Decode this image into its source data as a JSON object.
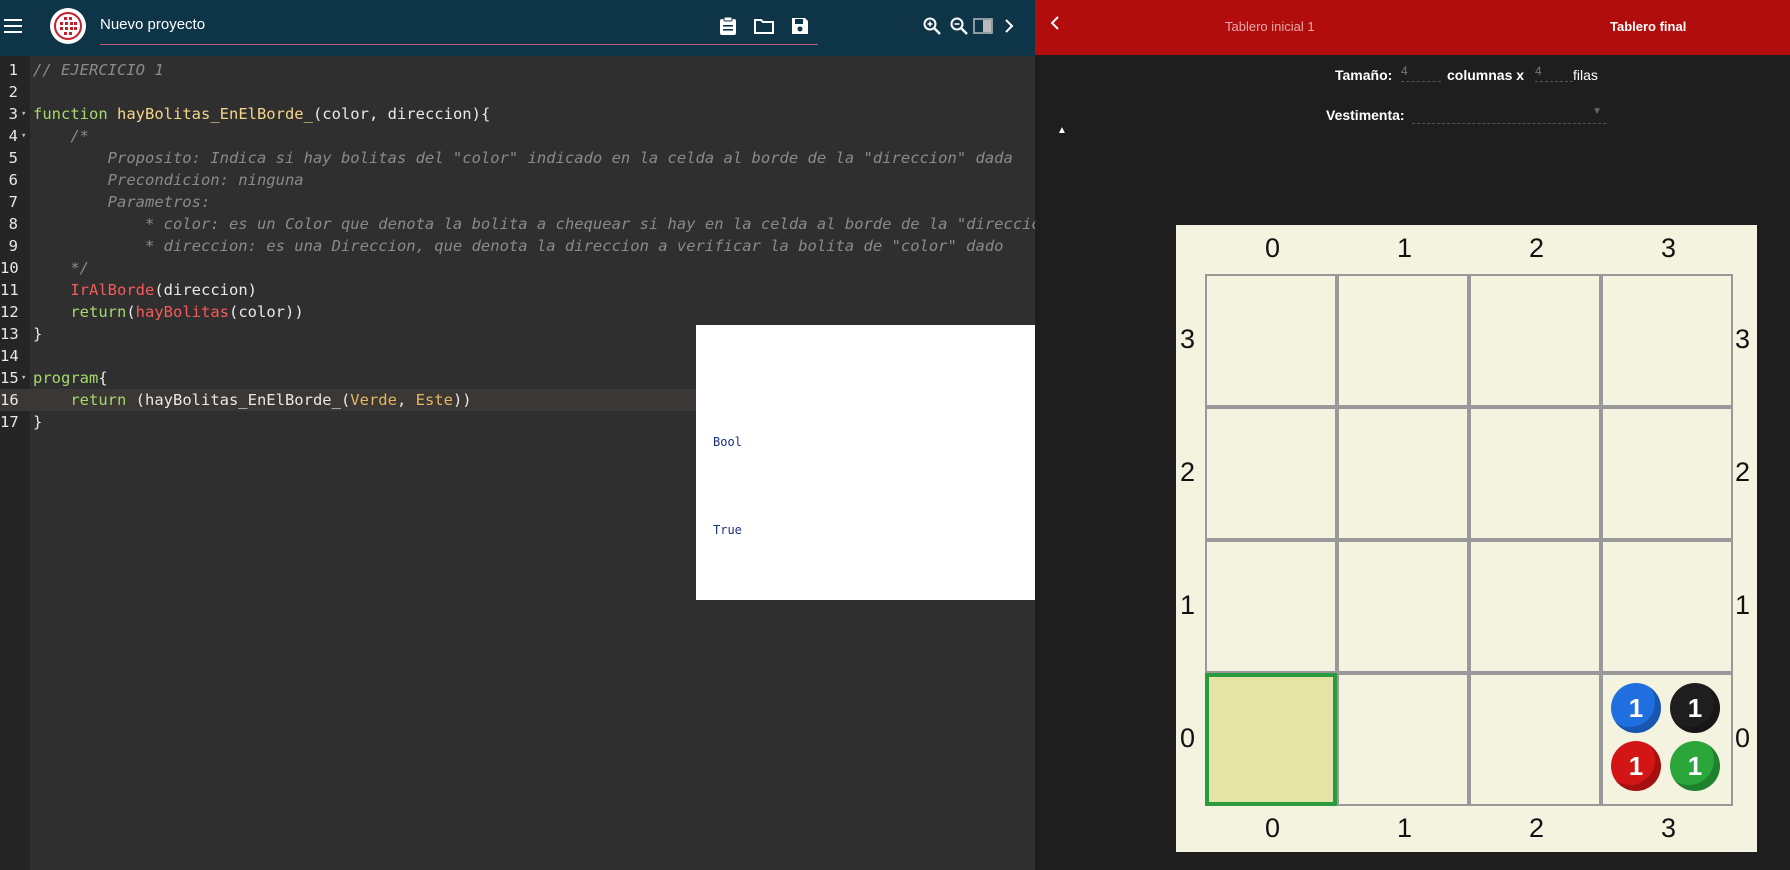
{
  "header": {
    "title": "Nuevo proyecto"
  },
  "editor": {
    "lines": [
      {
        "n": "1",
        "fold": "",
        "parts": [
          {
            "t": "// EJERCICIO 1",
            "c": "c-comment"
          }
        ]
      },
      {
        "n": "2",
        "fold": "",
        "parts": []
      },
      {
        "n": "3",
        "fold": "▾",
        "parts": [
          {
            "t": "function ",
            "c": "c-kw"
          },
          {
            "t": "hayBolitas_EnElBorde_",
            "c": "c-fn"
          },
          {
            "t": "(color, direccion){",
            "c": ""
          }
        ]
      },
      {
        "n": "4",
        "fold": "▾",
        "parts": [
          {
            "t": "    /*",
            "c": "c-comment"
          }
        ]
      },
      {
        "n": "5",
        "fold": "",
        "parts": [
          {
            "t": "        Proposito: Indica si hay bolitas del \"color\" indicado en la celda al borde de la \"direccion\" dada",
            "c": "c-comment"
          }
        ]
      },
      {
        "n": "6",
        "fold": "",
        "parts": [
          {
            "t": "        Precondicion: ninguna",
            "c": "c-comment"
          }
        ]
      },
      {
        "n": "7",
        "fold": "",
        "parts": [
          {
            "t": "        Parametros:",
            "c": "c-comment"
          }
        ]
      },
      {
        "n": "8",
        "fold": "",
        "parts": [
          {
            "t": "            * color: es un Color que denota la bolita a chequear si hay en la celda al borde de la \"direccion\"",
            "c": "c-comment"
          }
        ]
      },
      {
        "n": "9",
        "fold": "",
        "parts": [
          {
            "t": "            * direccion: es una Direccion, que denota la direccion a verificar la bolita de \"color\" dado",
            "c": "c-comment"
          }
        ]
      },
      {
        "n": "10",
        "fold": "",
        "parts": [
          {
            "t": "    */",
            "c": "c-comment"
          }
        ]
      },
      {
        "n": "11",
        "fold": "",
        "parts": [
          {
            "t": "    ",
            "c": ""
          },
          {
            "t": "IrAlBorde",
            "c": "c-red"
          },
          {
            "t": "(direccion)",
            "c": ""
          }
        ]
      },
      {
        "n": "12",
        "fold": "",
        "parts": [
          {
            "t": "    ",
            "c": ""
          },
          {
            "t": "return",
            "c": "c-kw"
          },
          {
            "t": "(",
            "c": ""
          },
          {
            "t": "hayBolitas",
            "c": "c-red"
          },
          {
            "t": "(color))",
            "c": ""
          }
        ]
      },
      {
        "n": "13",
        "fold": "",
        "parts": [
          {
            "t": "}",
            "c": ""
          }
        ]
      },
      {
        "n": "14",
        "fold": "",
        "parts": []
      },
      {
        "n": "15",
        "fold": "▾",
        "parts": [
          {
            "t": "program",
            "c": "c-kw"
          },
          {
            "t": "{",
            "c": ""
          }
        ]
      },
      {
        "n": "16",
        "fold": "",
        "active": true,
        "parts": [
          {
            "t": "    ",
            "c": ""
          },
          {
            "t": "return",
            "c": "c-kw"
          },
          {
            "t": " (hayBolitas_EnElBorde_(",
            "c": ""
          },
          {
            "t": "Verde",
            "c": "c-const"
          },
          {
            "t": ", ",
            "c": ""
          },
          {
            "t": "Este",
            "c": "c-const"
          },
          {
            "t": "))",
            "c": ""
          }
        ]
      },
      {
        "n": "17",
        "fold": "",
        "parts": [
          {
            "t": "}",
            "c": ""
          }
        ]
      }
    ]
  },
  "popup": {
    "type_value": "Bool",
    "result_value": "True"
  },
  "board_panel": {
    "tab_initial": "Tablero inicial 1",
    "tab_final": "Tablero final",
    "size_label": "Tamaño:",
    "columns_value": "4",
    "columns_label": "columnas x",
    "rows_value": "4",
    "rows_label": "filas",
    "costume_label": "Vestimenta:"
  },
  "board": {
    "columns": 4,
    "rows": 4,
    "col_labels": [
      "0",
      "1",
      "2",
      "3"
    ],
    "row_labels": [
      "3",
      "2",
      "1",
      "0"
    ],
    "head": {
      "col": 0,
      "row": 0
    },
    "balls": [
      {
        "col": 3,
        "row": 0,
        "color": "blue",
        "count": "1",
        "hex": "#1f6fe0"
      },
      {
        "col": 3,
        "row": 0,
        "color": "black",
        "count": "1",
        "hex": "#1e1e1e"
      },
      {
        "col": 3,
        "row": 0,
        "color": "red",
        "count": "1",
        "hex": "#d31515"
      },
      {
        "col": 3,
        "row": 0,
        "color": "green",
        "count": "1",
        "hex": "#2aa63a"
      }
    ]
  },
  "colors": {
    "header_bg": "#0e3447",
    "board_bar_bg": "#b20d0d",
    "board_bg": "#f4f3df",
    "head_border": "#2a9a3f"
  }
}
